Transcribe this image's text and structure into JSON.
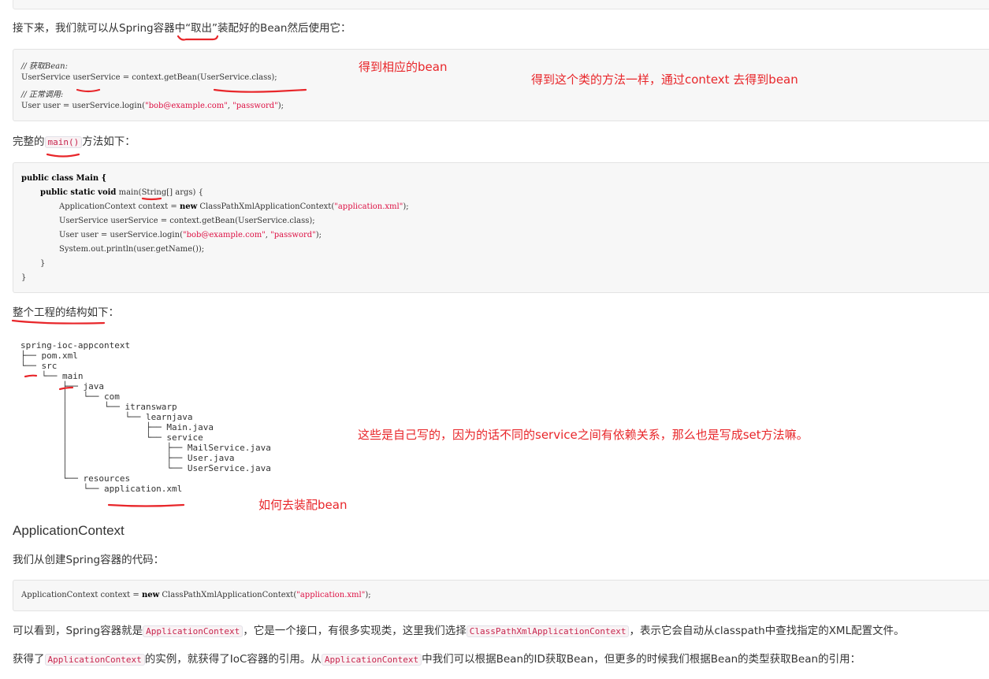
{
  "intro": "接下来，我们就可以从Spring容器中“取出”装配好的Bean然后使用它：",
  "code1": {
    "line1": "// 获取Bean:",
    "line2": "UserService userService = context.getBean(UserService.class);",
    "line3": "// 正常调用:",
    "line4_a": "User user = userService.login(",
    "line4_s1": "\"bob@example.com\"",
    "line4_sep": ", ",
    "line4_s2": "\"password\"",
    "line4_b": ");"
  },
  "main_para": {
    "before": "完整的",
    "code": "main()",
    "after": "方法如下："
  },
  "code2": {
    "l1_kw": "public class",
    "l1_rest": " Main {",
    "l2_kw": "public static void",
    "l2_rest": " main(String[] args) {",
    "l3_a": "ApplicationContext context = ",
    "l3_kw": "new",
    "l3_b": " ClassPathXmlApplicationContext(",
    "l3_s": "\"application.xml\"",
    "l3_c": ");",
    "l4": "UserService userService = context.getBean(UserService.class);",
    "l5_a": "User user = userService.login(",
    "l5_s1": "\"bob@example.com\"",
    "l5_sep": ", ",
    "l5_s2": "\"password\"",
    "l5_b": ");",
    "l6": "System.out.println(user.getName());",
    "l7": "}",
    "l8": "}"
  },
  "structure_title": "整个工程的结构如下：",
  "tree": [
    "spring-ioc-appcontext",
    "├── pom.xml",
    "└── src",
    "    └── main",
    "        ├── java",
    "        │   └── com",
    "        │       └── itranswarp",
    "        │           └── learnjava",
    "        │               ├── Main.java",
    "        │               └── service",
    "        │                   ├── MailService.java",
    "        │                   ├── User.java",
    "        │                   └── UserService.java",
    "        └── resources",
    "            └── application.xml"
  ],
  "heading": "ApplicationContext",
  "create_para": "我们从创建Spring容器的代码：",
  "code3": {
    "a": "ApplicationContext context = ",
    "kw": "new",
    "b": " ClassPathXmlApplicationContext(",
    "s": "\"application.xml\"",
    "c": ");"
  },
  "para_see": {
    "t1": "可以看到，Spring容器就是",
    "c1": "ApplicationContext",
    "t2": "，它是一个接口，有很多实现类，这里我们选择",
    "c2": "ClassPathXmlApplicationContext",
    "t3": "，表示它会自动从classpath中查找指定的XML配置文件。"
  },
  "para_got": {
    "t1": "获得了",
    "c1": "ApplicationContext",
    "t2": "的实例，就获得了IoC容器的引用。从",
    "c2": "ApplicationContext",
    "t3": "中我们可以根据Bean的ID获取Bean，但更多的时候我们根据Bean的类型获取Bean的引用："
  },
  "annotations": {
    "get_bean": "得到相应的bean",
    "same_method": "得到这个类的方法一样，通过context  去得到bean",
    "self_written": "这些是自己写的，因为的话不同的service之间有依赖关系，那么也是写成set方法嘛。",
    "how_assemble": "如何去装配bean"
  },
  "colors": {
    "annotation": "#e8262a",
    "code_bg": "#f7f7f7",
    "inline_code": "#c7254e",
    "string": "#d14"
  }
}
